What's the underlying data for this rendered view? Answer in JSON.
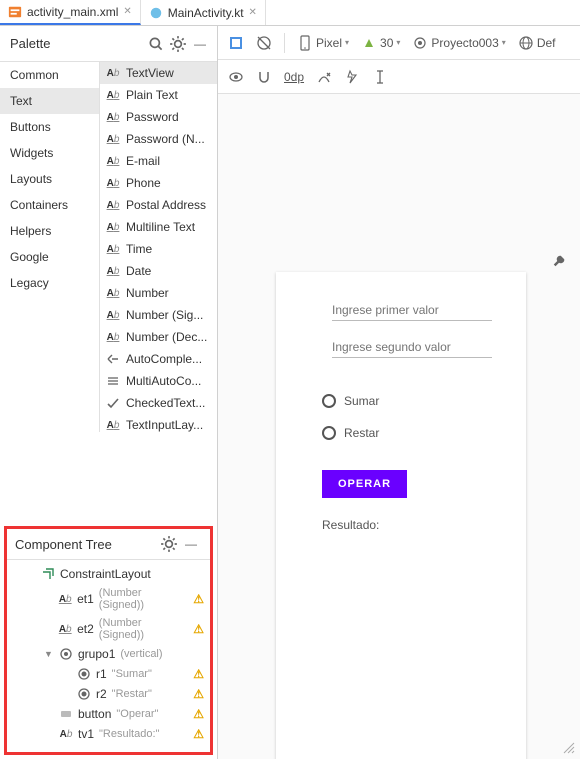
{
  "tabs": [
    {
      "label": "activity_main.xml",
      "icon": "xml-file-icon",
      "active": true
    },
    {
      "label": "MainActivity.kt",
      "icon": "kotlin-file-icon",
      "active": false
    }
  ],
  "palette": {
    "title": "Palette",
    "categories": [
      "Common",
      "Text",
      "Buttons",
      "Widgets",
      "Layouts",
      "Containers",
      "Helpers",
      "Google",
      "Legacy"
    ],
    "selected_category": "Text",
    "items": [
      {
        "label": "TextView",
        "icon": "ab"
      },
      {
        "label": "Plain Text",
        "icon": "ab-u"
      },
      {
        "label": "Password",
        "icon": "ab-u"
      },
      {
        "label": "Password (N...",
        "icon": "ab-u"
      },
      {
        "label": "E-mail",
        "icon": "ab-u"
      },
      {
        "label": "Phone",
        "icon": "ab-u"
      },
      {
        "label": "Postal Address",
        "icon": "ab-u"
      },
      {
        "label": "Multiline Text",
        "icon": "ab-u"
      },
      {
        "label": "Time",
        "icon": "ab-u"
      },
      {
        "label": "Date",
        "icon": "ab-u"
      },
      {
        "label": "Number",
        "icon": "ab-u"
      },
      {
        "label": "Number (Sig...",
        "icon": "ab-u"
      },
      {
        "label": "Number (Dec...",
        "icon": "ab-u"
      },
      {
        "label": "AutoComple...",
        "icon": "auto"
      },
      {
        "label": "MultiAutoCo...",
        "icon": "multi"
      },
      {
        "label": "CheckedText...",
        "icon": "check"
      },
      {
        "label": "TextInputLay...",
        "icon": "ab-u"
      }
    ],
    "selected_item": "TextView"
  },
  "tree": {
    "title": "Component Tree",
    "nodes": [
      {
        "depth": 0,
        "icon": "layout",
        "name": "ConstraintLayout",
        "hint": "",
        "warn": false,
        "expand": ""
      },
      {
        "depth": 1,
        "icon": "ab-u",
        "name": "et1",
        "hint": "(Number (Signed))",
        "warn": true,
        "expand": ""
      },
      {
        "depth": 1,
        "icon": "ab-u",
        "name": "et2",
        "hint": "(Number (Signed))",
        "warn": true,
        "expand": ""
      },
      {
        "depth": 1,
        "icon": "radio-g",
        "name": "grupo1",
        "hint": "(vertical)",
        "warn": false,
        "expand": "▼"
      },
      {
        "depth": 2,
        "icon": "radio",
        "name": "r1",
        "hint": "\"Sumar\"",
        "warn": true,
        "expand": ""
      },
      {
        "depth": 2,
        "icon": "radio",
        "name": "r2",
        "hint": "\"Restar\"",
        "warn": true,
        "expand": ""
      },
      {
        "depth": 1,
        "icon": "button",
        "name": "button",
        "hint": "\"Operar\"",
        "warn": true,
        "expand": ""
      },
      {
        "depth": 1,
        "icon": "ab",
        "name": "tv1",
        "hint": "\"Resultado:\"",
        "warn": true,
        "expand": ""
      }
    ]
  },
  "design_toolbar": {
    "device": "Pixel",
    "api": "30",
    "project": "Proyecto003",
    "locale": "Def",
    "zoom": "0dp"
  },
  "preview": {
    "field1_placeholder": "Ingrese primer valor",
    "field2_placeholder": "Ingrese segundo valor",
    "radio1": "Sumar",
    "radio2": "Restar",
    "button": "OPERAR",
    "result": "Resultado:"
  },
  "colors": {
    "accent": "#6a00ff",
    "highlight_border": "#e33",
    "tab_active": "#3b78e7"
  }
}
